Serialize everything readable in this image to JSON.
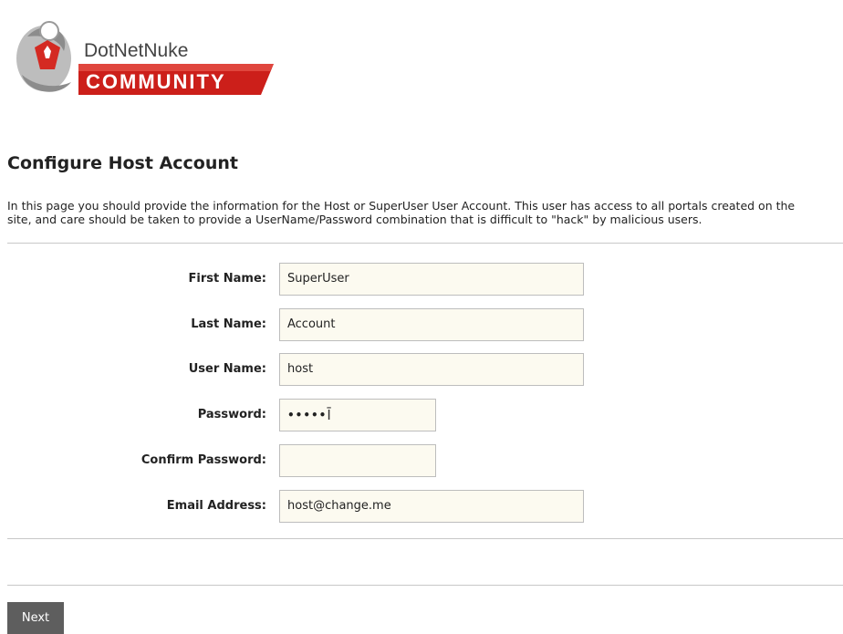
{
  "logo": {
    "line1": "DotNetNuke",
    "line2": "COMMUNITY"
  },
  "page": {
    "title": "Configure Host Account",
    "intro_line1": "In this page you should provide the information for the Host or SuperUser User Account. This user has access to all portals created on the",
    "intro_line2": "site, and care should be taken to provide a UserName/Password combination that is difficult to \"hack\" by malicious users."
  },
  "form": {
    "first_name": {
      "label": "First Name:",
      "value": "SuperUser"
    },
    "last_name": {
      "label": "Last Name:",
      "value": "Account"
    },
    "user_name": {
      "label": "User Name:",
      "value": "host"
    },
    "password": {
      "label": "Password:",
      "value": "•••••"
    },
    "confirm_password": {
      "label": "Confirm Password:",
      "value": ""
    },
    "email": {
      "label": "Email Address:",
      "value": "host@change.me"
    }
  },
  "actions": {
    "next_label": "Next"
  },
  "colors": {
    "brand_red": "#cc1f1a",
    "input_bg": "#fcfaf0",
    "button_bg": "#5e5e5e"
  }
}
